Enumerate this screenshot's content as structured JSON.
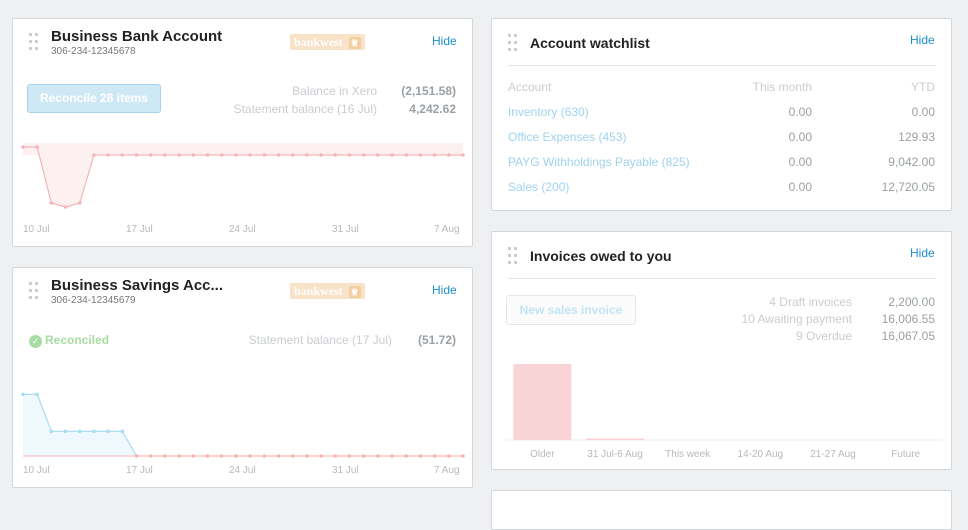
{
  "bank_account": {
    "title": "Business Bank Account",
    "number": "306-234-12345678",
    "logo": "bankwest",
    "hide": "Hide",
    "reconcile_button": "Reconcile 28 items",
    "balance_xero_label": "Balance in Xero",
    "balance_xero_value": "(2,151.58)",
    "statement_label": "Statement balance (16 Jul)",
    "statement_value": "4,242.62",
    "axis": [
      "10 Jul",
      "17 Jul",
      "24 Jul",
      "31 Jul",
      "7 Aug"
    ]
  },
  "savings_account": {
    "title": "Business Savings Acc...",
    "number": "306-234-12345679",
    "logo": "bankwest",
    "hide": "Hide",
    "status": "Reconciled",
    "statement_label": "Statement balance (17 Jul)",
    "statement_value": "(51.72)",
    "axis": [
      "10 Jul",
      "17 Jul",
      "24 Jul",
      "31 Jul",
      "7 Aug"
    ]
  },
  "watchlist": {
    "title": "Account watchlist",
    "hide": "Hide",
    "headers": [
      "Account",
      "This month",
      "YTD"
    ],
    "rows": [
      {
        "account": "Inventory (630)",
        "month": "0.00",
        "ytd": "0.00"
      },
      {
        "account": "Office Expenses (453)",
        "month": "0.00",
        "ytd": "129.93"
      },
      {
        "account": "PAYG Withholdings Payable (825)",
        "month": "0.00",
        "ytd": "9,042.00"
      },
      {
        "account": "Sales (200)",
        "month": "0.00",
        "ytd": "12,720.05"
      }
    ]
  },
  "invoices": {
    "title": "Invoices owed to you",
    "hide": "Hide",
    "new_button": "New sales invoice",
    "stats": [
      {
        "label": "4 Draft invoices",
        "value": "2,200.00"
      },
      {
        "label": "10 Awaiting payment",
        "value": "16,006.55"
      },
      {
        "label": "9 Overdue",
        "value": "16,067.05"
      }
    ]
  },
  "chart_data": [
    {
      "type": "area",
      "series": [
        {
          "values": [
            2,
            2,
            -12,
            -13,
            -12,
            0,
            0,
            0,
            0,
            0,
            0,
            0,
            0,
            0,
            0,
            0,
            0,
            0,
            0,
            0,
            0,
            0,
            0,
            0,
            0,
            0,
            0,
            0,
            0,
            0,
            0,
            0
          ]
        }
      ],
      "x_ticks": [
        "10 Jul",
        "17 Jul",
        "24 Jul",
        "31 Jul",
        "7 Aug"
      ],
      "ylim": [
        -15,
        3
      ],
      "colors": {
        "line": "#f5b5b8",
        "fill": "#fdf0f0"
      }
    },
    {
      "type": "area",
      "series": [
        {
          "values": [
            5,
            5,
            2,
            2,
            2,
            2,
            2,
            2,
            0,
            0,
            0,
            0,
            0,
            0,
            0,
            0,
            0,
            0,
            0,
            0,
            0,
            0,
            0,
            0,
            0,
            0,
            0,
            0,
            0,
            0,
            0,
            0
          ]
        }
      ],
      "x_ticks": [
        "10 Jul",
        "17 Jul",
        "24 Jul",
        "31 Jul",
        "7 Aug"
      ],
      "ylim": [
        0,
        6
      ],
      "colors": {
        "line": "#a9ddf2",
        "fill": "#eef8fd",
        "zero_line": "#f5b5b8"
      }
    },
    {
      "type": "bar",
      "categories": [
        "Older",
        "31 Jul-6 Aug",
        "This week",
        "14-20 Aug",
        "21-27 Aug",
        "Future"
      ],
      "values": [
        16067.05,
        180,
        0,
        0,
        0,
        0
      ],
      "ylim": [
        0,
        16067.05
      ],
      "colors": {
        "bar": "#f9d4d6",
        "baseline": "#eceeef"
      }
    }
  ]
}
